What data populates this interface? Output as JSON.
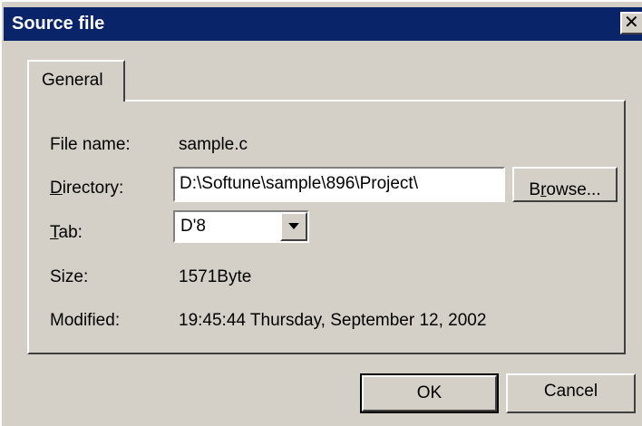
{
  "window": {
    "title": "Source file"
  },
  "tabs": [
    {
      "label": "General"
    }
  ],
  "fields": {
    "file_name_label": "File name:",
    "file_name_value": "sample.c",
    "directory_label_hotkey": "D",
    "directory_label_rest": "irectory:",
    "directory_value": "D:\\Softune\\sample\\896\\Project\\",
    "tab_label_hotkey": "T",
    "tab_label_rest": "ab:",
    "tab_value": "D'8",
    "size_label": "Size:",
    "size_value": "1571Byte",
    "modified_label": "Modified:",
    "modified_value": "19:45:44 Thursday, September 12, 2002"
  },
  "buttons": {
    "browse_pre": "B",
    "browse_hotkey": "r",
    "browse_post": "owse...",
    "ok": "OK",
    "cancel": "Cancel"
  },
  "colors": {
    "titlebar": "#0a246a",
    "face": "#d4d0c8"
  },
  "icons": {
    "close": "close-icon",
    "dropdown": "chevron-down-icon"
  }
}
